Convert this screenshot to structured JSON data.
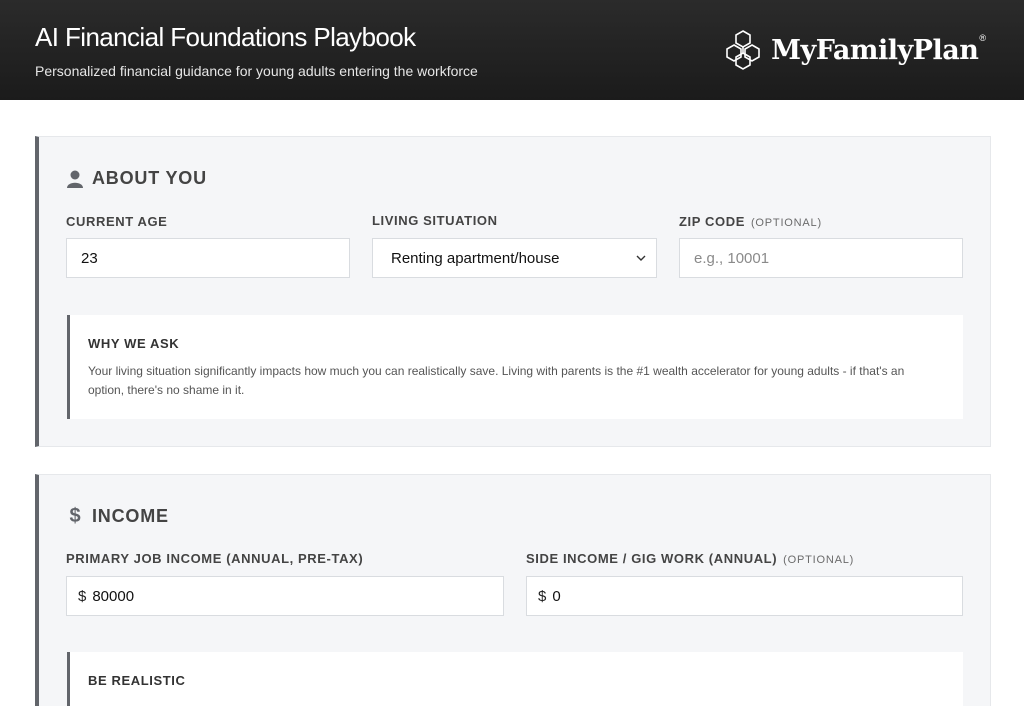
{
  "header": {
    "title": "AI Financial Foundations Playbook",
    "subtitle": "Personalized financial guidance for young adults entering the workforce",
    "brand": "MyFamilyPlan",
    "brand_mark": "®",
    "logo_icon": "hexagon-cluster-logo-icon"
  },
  "about": {
    "heading": "ABOUT YOU",
    "icon": "person-icon",
    "age_label": "CURRENT AGE",
    "age_value": "23",
    "living_label": "LIVING SITUATION",
    "living_value": "Renting apartment/house",
    "zip_label": "ZIP CODE",
    "zip_optional": "(OPTIONAL)",
    "zip_placeholder": "e.g., 10001",
    "note_title": "WHY WE ASK",
    "note_body": "Your living situation significantly impacts how much you can realistically save. Living with parents is the #1 wealth accelerator for young adults - if that's an option, there's no shame in it."
  },
  "income": {
    "heading": "INCOME",
    "icon": "$",
    "primary_label": "PRIMARY JOB INCOME (ANNUAL, PRE-TAX)",
    "primary_currency": "$",
    "primary_value": "80000",
    "side_label": "SIDE INCOME / GIG WORK (ANNUAL)",
    "side_optional": "(OPTIONAL)",
    "side_currency": "$",
    "side_value": "0",
    "note_title": "BE REALISTIC"
  },
  "colors": {
    "header_bg": "#1f1f1f",
    "accent": "#62656b",
    "panel_bg": "#f5f6f8"
  }
}
